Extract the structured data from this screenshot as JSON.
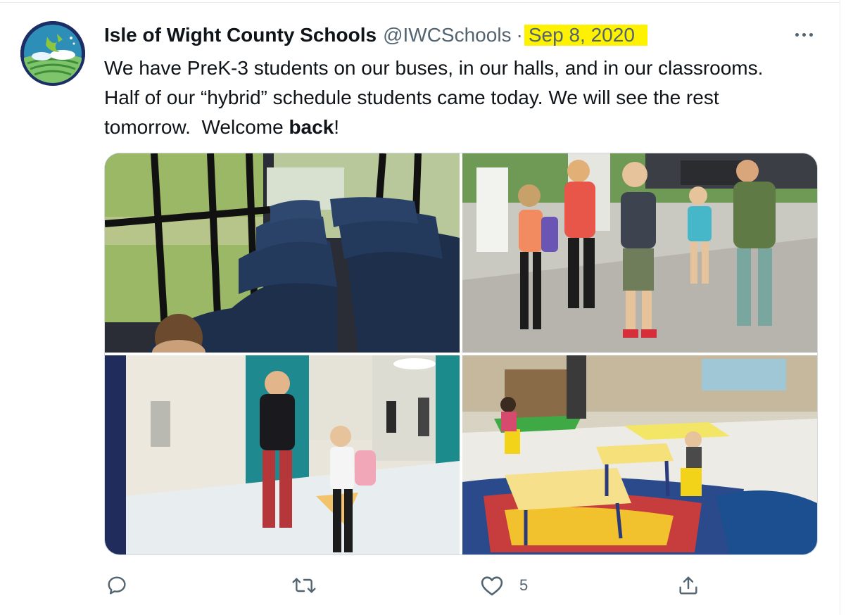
{
  "tweet": {
    "author_name": "Isle of Wight County Schools",
    "author_handle": "@IWCSchools",
    "separator": "·",
    "date": "Sep 8, 2020",
    "text_line1": "We have PreK-3 students on our buses, in our halls, and in our classrooms.",
    "text_line2": "Half of our “hybrid” schedule students came today. We will see the rest",
    "text_line3_pre": "tomorrow.  Welcome ",
    "text_line3_bold": "back",
    "text_line3_post": "!"
  },
  "actions": {
    "like_count": "5"
  },
  "colors": {
    "highlight": "#fff200",
    "secondary_text": "#536471",
    "border": "#cfd9de"
  },
  "icons": {
    "more": "more-horizontal-icon",
    "reply": "reply-icon",
    "retweet": "retweet-icon",
    "like": "heart-icon",
    "share": "share-icon"
  }
}
